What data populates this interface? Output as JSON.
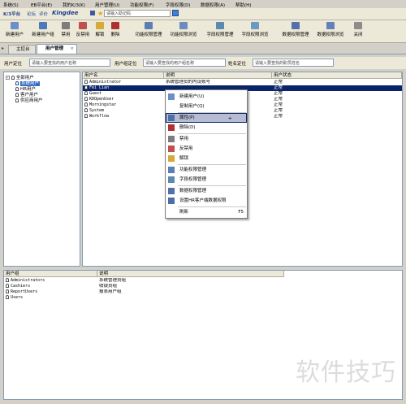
{
  "menu": [
    "系统(S)",
    "EB平台(E)",
    "我的K/3(K)",
    "用户管理(U)",
    "功能权限(F)",
    "字段权限(D)",
    "数据权限(A)",
    "帮助(H)"
  ],
  "linkbar": {
    "platform": "K/3平台",
    "forum": "论坛",
    "review": "评价",
    "brand": "Kingdee",
    "search_placeholder": "请输入助记码"
  },
  "toolbar": [
    "新建用户",
    "新建用户组",
    "禁用",
    "反禁用",
    "解锁",
    "删除",
    "功能权限管理",
    "功能权限浏览",
    "字段权限管理",
    "字段权限浏览",
    "数据权限管理",
    "数据权限浏览",
    "关闭"
  ],
  "tabs": [
    "主控台",
    "用户管理"
  ],
  "filter": {
    "user_label": "用户定位",
    "user_placeholder": "请输入要查找的用户名称",
    "group_label": "用户组定位",
    "group_placeholder": "请输入要查找的用户组名称",
    "org_label": "姓名定位",
    "org_placeholder": "请输入要查找的职员姓名"
  },
  "tree": {
    "root": "全部用户",
    "children": [
      "系统用户",
      "HR用户",
      "客户用户",
      "供应商用户"
    ]
  },
  "users": {
    "columns": [
      "用户名",
      "说明",
      "用户状态"
    ],
    "rows": [
      {
        "name": "Administrator",
        "desc": "系统管理员的内设账号",
        "status": "正常"
      },
      {
        "name": "Fei Lian",
        "desc": "",
        "status": "正常"
      },
      {
        "name": "Guest",
        "desc": "",
        "status": "正常"
      },
      {
        "name": "KDOpenUser",
        "desc": "",
        "status": "正常"
      },
      {
        "name": "Morningstar",
        "desc": "",
        "status": "正常"
      },
      {
        "name": "System",
        "desc": "",
        "status": "正常"
      },
      {
        "name": "Workflow",
        "desc": "",
        "status": "正常"
      }
    ]
  },
  "context_menu": [
    {
      "label": "新建用户(U)",
      "icon": "new-user-icon"
    },
    {
      "label": "复制用户(Q)",
      "icon": ""
    },
    {
      "label": "属性(P)",
      "icon": "properties-icon"
    },
    {
      "label": "删除(D)",
      "icon": "delete-icon"
    },
    {
      "label": "禁用",
      "icon": "disable-icon"
    },
    {
      "label": "反禁用",
      "icon": "enable-icon"
    },
    {
      "label": "解锁",
      "icon": "unlock-icon"
    },
    {
      "label": "功能权限管理",
      "icon": "function-permission-icon"
    },
    {
      "label": "字段权限管理",
      "icon": "field-permission-icon"
    },
    {
      "label": "数据权限管理",
      "icon": "data-permission-icon"
    },
    {
      "label": "设置HR客户端数据权限",
      "icon": "hr-permission-icon"
    },
    {
      "label": "刷新",
      "icon": "",
      "shortcut": "F5"
    }
  ],
  "groups": {
    "columns": [
      "用户组",
      "说明"
    ],
    "rows": [
      {
        "name": "Administrators",
        "desc": "系统管理员组"
      },
      {
        "name": "Cashiers",
        "desc": "收银员组"
      },
      {
        "name": "ReportUsers",
        "desc": "报表用户组"
      },
      {
        "name": "Users",
        "desc": ""
      }
    ]
  },
  "watermark": "软件技巧",
  "colors": {
    "selection": "#0a246a",
    "menu_highlight": "#b6bdd2"
  }
}
